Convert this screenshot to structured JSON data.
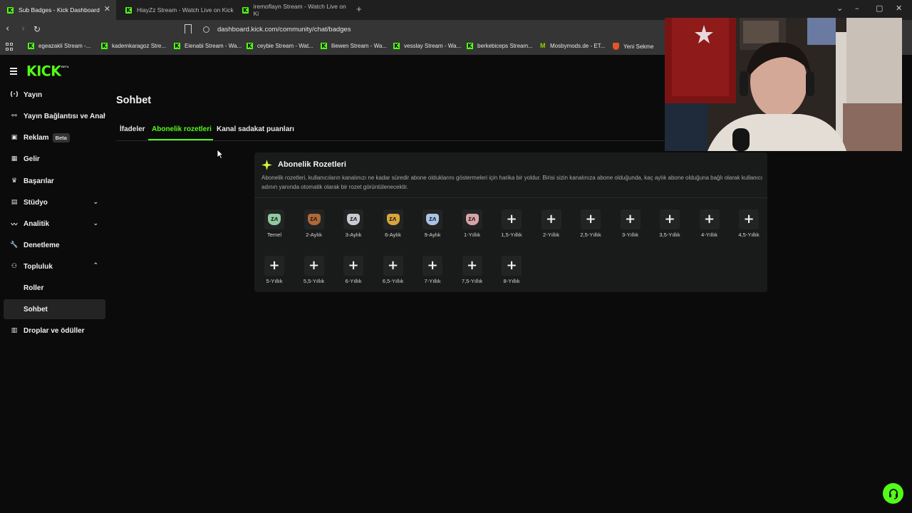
{
  "browser": {
    "tabs": [
      {
        "title": "Sub Badges - Kick Dashboard",
        "active": true
      },
      {
        "title": "HiayZz Stream - Watch Live on Kick",
        "active": false
      },
      {
        "title": "iremoflayn Stream - Watch Live on Ki",
        "active": false
      }
    ],
    "url": "dashboard.kick.com/community/chat/badges",
    "bookmarks": [
      {
        "label": "egeazakli Stream -...",
        "icon": "kick-icon"
      },
      {
        "label": "kademkaragoz Stre...",
        "icon": "kick-icon"
      },
      {
        "label": "Eienabi Stream - Wa...",
        "icon": "kick-icon"
      },
      {
        "label": "ceybie Stream - Wat...",
        "icon": "kick-icon"
      },
      {
        "label": "lliewen Stream - Wa...",
        "icon": "kick-icon"
      },
      {
        "label": "vesslay Stream - Wa...",
        "icon": "kick-icon"
      },
      {
        "label": "berkebiceps Stream...",
        "icon": "kick-icon"
      },
      {
        "label": "Mosbymods.de - ET...",
        "icon": "mosby-icon"
      },
      {
        "label": "Yeni Sekme",
        "icon": "brave-icon"
      }
    ]
  },
  "sidebar": {
    "logo": "KICK",
    "logo_tag": "BETA",
    "items": [
      {
        "label": "Yayın",
        "icon": "broadcast-icon"
      },
      {
        "label": "Yayın Bağlantısı ve Anahtarı",
        "icon": "link-icon"
      },
      {
        "label": "Reklam",
        "icon": "ad-icon",
        "badge": "Beta"
      },
      {
        "label": "Gelir",
        "icon": "revenue-icon"
      },
      {
        "label": "Başarılar",
        "icon": "trophy-icon"
      },
      {
        "label": "Stüdyo",
        "icon": "studio-icon",
        "expandable": true
      },
      {
        "label": "Analitik",
        "icon": "analytics-icon",
        "expandable": true
      },
      {
        "label": "Denetleme",
        "icon": "wrench-icon"
      },
      {
        "label": "Topluluk",
        "icon": "community-icon",
        "expanded": true
      },
      {
        "label": "Roller",
        "sub": true
      },
      {
        "label": "Sohbet",
        "sub": true,
        "active": true
      },
      {
        "label": "Droplar ve ödüller",
        "icon": "gift-icon"
      }
    ]
  },
  "main": {
    "title": "Sohbet",
    "tabs": [
      {
        "label": "İfadeler",
        "active": false
      },
      {
        "label": "Abonelik rozetleri",
        "active": true
      },
      {
        "label": "Kanal sadakat puanları",
        "active": false
      }
    ],
    "card": {
      "title": "Abonelik Rozetleri",
      "description": "Abonelik rozetleri, kullanıcıların kanalınızı ne kadar süredir abone olduklarını göstermeleri için harika bir yoldur. Birisi sizin kanalınıza abone olduğunda, kaç aylık abone olduğuna bağlı olarak kullanıcı adının yanında otomatik olarak bir rozet görüntülenecektir.",
      "badges": [
        {
          "label": "Temel",
          "set": true,
          "color": "#8fc9a0"
        },
        {
          "label": "2-Aylık",
          "set": true,
          "color": "#b0683a"
        },
        {
          "label": "3-Aylık",
          "set": true,
          "color": "#c8ccd2"
        },
        {
          "label": "6-Aylık",
          "set": true,
          "color": "#d9a53c"
        },
        {
          "label": "9-Aylık",
          "set": true,
          "color": "#a9c4e6"
        },
        {
          "label": "1-Yıllık",
          "set": true,
          "color": "#d7a3a8"
        },
        {
          "label": "1,5-Yıllık",
          "set": false
        },
        {
          "label": "2-Yıllık",
          "set": false
        },
        {
          "label": "2,5-Yıllık",
          "set": false
        },
        {
          "label": "3-Yıllık",
          "set": false
        },
        {
          "label": "3,5-Yıllık",
          "set": false
        },
        {
          "label": "4-Yıllık",
          "set": false
        },
        {
          "label": "4,5-Yıllık",
          "set": false
        },
        {
          "label": "5-Yıllık",
          "set": false
        },
        {
          "label": "5,5-Yıllık",
          "set": false
        },
        {
          "label": "6-Yıllık",
          "set": false
        },
        {
          "label": "6,5-Yıllık",
          "set": false
        },
        {
          "label": "7-Yıllık",
          "set": false
        },
        {
          "label": "7,5-Yıllık",
          "set": false
        },
        {
          "label": "8-Yıllık",
          "set": false
        }
      ]
    }
  },
  "colors": {
    "accent": "#53fc18",
    "background": "#0b0b0b",
    "card": "#191a1a"
  }
}
